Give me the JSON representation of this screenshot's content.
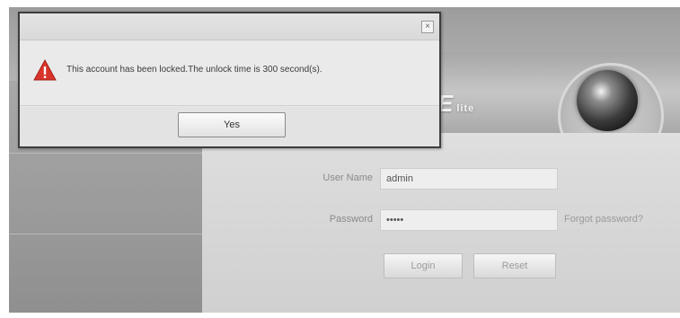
{
  "login": {
    "banner_logo": "E",
    "banner_logo_suffix": "lite",
    "username_label": "User Name",
    "username_value": "admin",
    "password_label": "Password",
    "password_value": "•••••",
    "forgot_link": "Forgot password?",
    "login_button": "Login",
    "reset_button": "Reset"
  },
  "dialog": {
    "message": "This account has been locked.The unlock time is 300 second(s).",
    "ok_button": "Yes",
    "close_glyph": "×",
    "icon": "warning-icon",
    "icon_color": "#d9342b"
  },
  "colors": {
    "dialog_border": "#3d3d3d",
    "panel_bg": "#dcdcdc"
  }
}
